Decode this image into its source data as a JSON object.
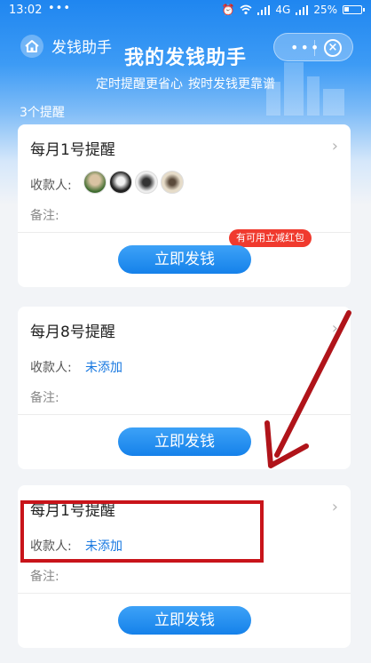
{
  "status_bar": {
    "time": "13:02",
    "dots": "•••",
    "network": "4G",
    "battery": "25%"
  },
  "titlebar": {
    "app_name": "发钱助手",
    "more_icon": "more-dots-icon",
    "close_icon": "close-circle-icon"
  },
  "hero": {
    "title": "我的发钱助手",
    "subtitle_parts": [
      "定时提醒更省心",
      "按时发钱更靠谱"
    ]
  },
  "reminder_count": "3个提醒",
  "cards": [
    {
      "title": "每月1号提醒",
      "payee_label": "收款人:",
      "payee_value": "",
      "note_label": "备注:",
      "button": "立即发钱",
      "promo": "有可用立减红包"
    },
    {
      "title": "每月8号提醒",
      "payee_label": "收款人:",
      "payee_value": "未添加",
      "note_label": "备注:",
      "button": "立即发钱"
    },
    {
      "title": "每月1号提醒",
      "payee_label": "收款人:",
      "payee_value": "未添加",
      "note_label": "备注:",
      "button": "立即发钱"
    }
  ],
  "colors": {
    "brand_blue": "#1581ea",
    "link_blue": "#1677e0",
    "promo_red": "#f03a2e",
    "annotation_red": "#c8141a"
  }
}
